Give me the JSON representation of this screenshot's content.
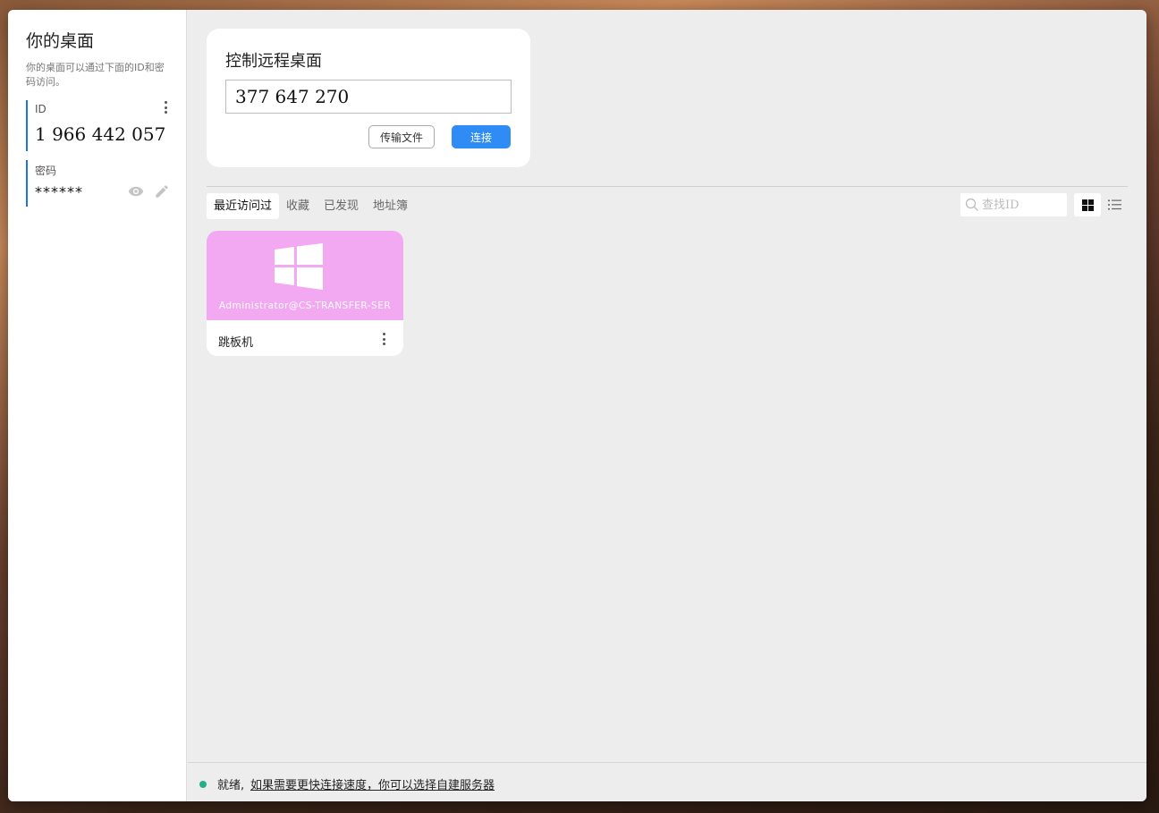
{
  "sidebar": {
    "title": "你的桌面",
    "description": "你的桌面可以通过下面的ID和密码访问。",
    "id_label": "ID",
    "id_value": "1 966 442 057",
    "password_label": "密码",
    "password_value": "******"
  },
  "connect": {
    "title": "控制远程桌面",
    "remote_id_value": "377 647 270",
    "transfer_label": "传输文件",
    "connect_label": "连接"
  },
  "tabs": [
    {
      "label": "最近访问过",
      "active": true
    },
    {
      "label": "收藏",
      "active": false
    },
    {
      "label": "已发现",
      "active": false
    },
    {
      "label": "地址簿",
      "active": false
    }
  ],
  "search": {
    "placeholder": "查找ID"
  },
  "peers": [
    {
      "user": "Administrator@CS-TRANSFER-SER",
      "name": "跳板机",
      "os_icon": "windows-icon",
      "banner_color": "#f2a9f2"
    }
  ],
  "status": {
    "ready": "就绪,",
    "link": "如果需要更快连接速度，你可以选择自建服务器"
  },
  "colors": {
    "accent": "#2f8cf5",
    "id_bar": "#1a73e8",
    "status_ok": "#21b08c"
  }
}
